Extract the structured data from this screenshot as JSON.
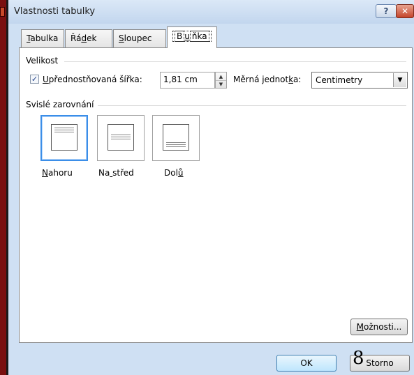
{
  "window": {
    "title": "Vlastnosti tabulky",
    "help_label": "?",
    "close_label": "✕"
  },
  "tabs": [
    {
      "pre": "",
      "accel": "T",
      "post": "abulka",
      "active": false
    },
    {
      "pre": "Řá",
      "accel": "d",
      "post": "ek",
      "active": false
    },
    {
      "pre": "",
      "accel": "S",
      "post": "loupec",
      "active": false
    },
    {
      "pre": "B",
      "accel": "u",
      "post": "ňka",
      "active": true
    }
  ],
  "size_group": {
    "title": "Velikost",
    "preferred_width": {
      "checked": true,
      "check_glyph": "✓",
      "label_pre": "",
      "label_accel": "U",
      "label_post": "přednostňovaná šířka:",
      "value": "1,81 cm"
    },
    "unit": {
      "label_pre": "Měrná jednot",
      "label_accel": "k",
      "label_post": "a:",
      "value": "Centimetry"
    }
  },
  "vertical_alignment": {
    "title": "Svislé zarovnání",
    "options": [
      {
        "pre": "",
        "accel": "N",
        "post": "ahoru",
        "selected": true
      },
      {
        "pre": "Na",
        "accel": " ",
        "post": "střed",
        "selected": false
      },
      {
        "pre": "Dol",
        "accel": "ů",
        "post": "",
        "selected": false
      }
    ]
  },
  "buttons": {
    "options": {
      "pre": "",
      "accel": "M",
      "post": "ožnosti..."
    },
    "ok": "OK",
    "cancel": "Storno"
  },
  "cursor_glyph": "8"
}
